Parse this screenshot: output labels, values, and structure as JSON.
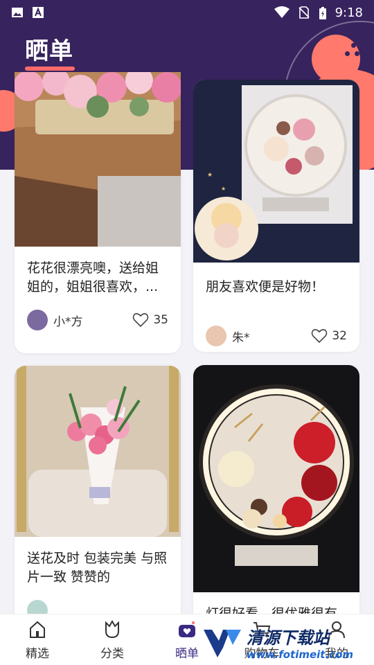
{
  "status_bar": {
    "time": "9:18",
    "left_icons": [
      "image-icon",
      "font-a-icon"
    ],
    "right_icons": [
      "wifi-icon",
      "no-sim-icon",
      "battery-charging-icon"
    ]
  },
  "header": {
    "title": "晒单",
    "background_color": "#37235e",
    "accent_color": "#ff6b6b"
  },
  "posts": [
    {
      "caption": "花花很漂亮噢，送给姐姐的，姐姐很喜欢，...",
      "author": "小*方",
      "likes": "35",
      "photo": "pink-roses-basket-on-wooden-table"
    },
    {
      "caption": "朋友喜欢便是好物！",
      "author": "朱*",
      "likes": "32",
      "photo": "preserved-flower-mirror-lamp-with-photos"
    },
    {
      "caption": "送花及时 包装完美 与照片一致 赞赞的",
      "author": "",
      "likes": "",
      "photo": "pink-carnation-lily-bouquet-on-chair"
    },
    {
      "caption": "灯很好看，很优雅很有",
      "author": "",
      "likes": "",
      "photo": "red-rose-led-ring-lamp"
    }
  ],
  "tabbar": {
    "items": [
      {
        "label": "精选",
        "icon": "house-icon",
        "active": false
      },
      {
        "label": "分类",
        "icon": "tulip-icon",
        "active": false
      },
      {
        "label": "晒单",
        "icon": "camera-heart-icon",
        "active": true
      },
      {
        "label": "购物车",
        "icon": "cart-icon",
        "active": false
      },
      {
        "label": "我的",
        "icon": "user-icon",
        "active": false
      }
    ],
    "active_color": "#3b2a82"
  },
  "watermark": {
    "title": "清源下载站",
    "url": "www.fotimeit.com"
  }
}
